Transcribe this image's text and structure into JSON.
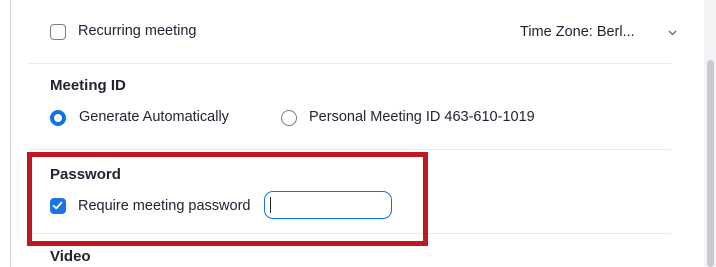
{
  "recurring": {
    "label": "Recurring meeting",
    "checked": false
  },
  "time_zone": {
    "label": "Time Zone: Berl...",
    "icon": "chevron-down-icon"
  },
  "meeting_id": {
    "heading": "Meeting ID",
    "options": [
      {
        "label": "Generate Automatically",
        "selected": true
      },
      {
        "label": "Personal Meeting ID 463-610-1019",
        "selected": false
      }
    ]
  },
  "password": {
    "heading": "Password",
    "require_label": "Require meeting password",
    "require_checked": true,
    "input_value": "",
    "highlight_color": "#c01822"
  },
  "video": {
    "heading": "Video"
  },
  "colors": {
    "accent": "#0e72ed",
    "checkbox_fill": "#1a73e8"
  }
}
